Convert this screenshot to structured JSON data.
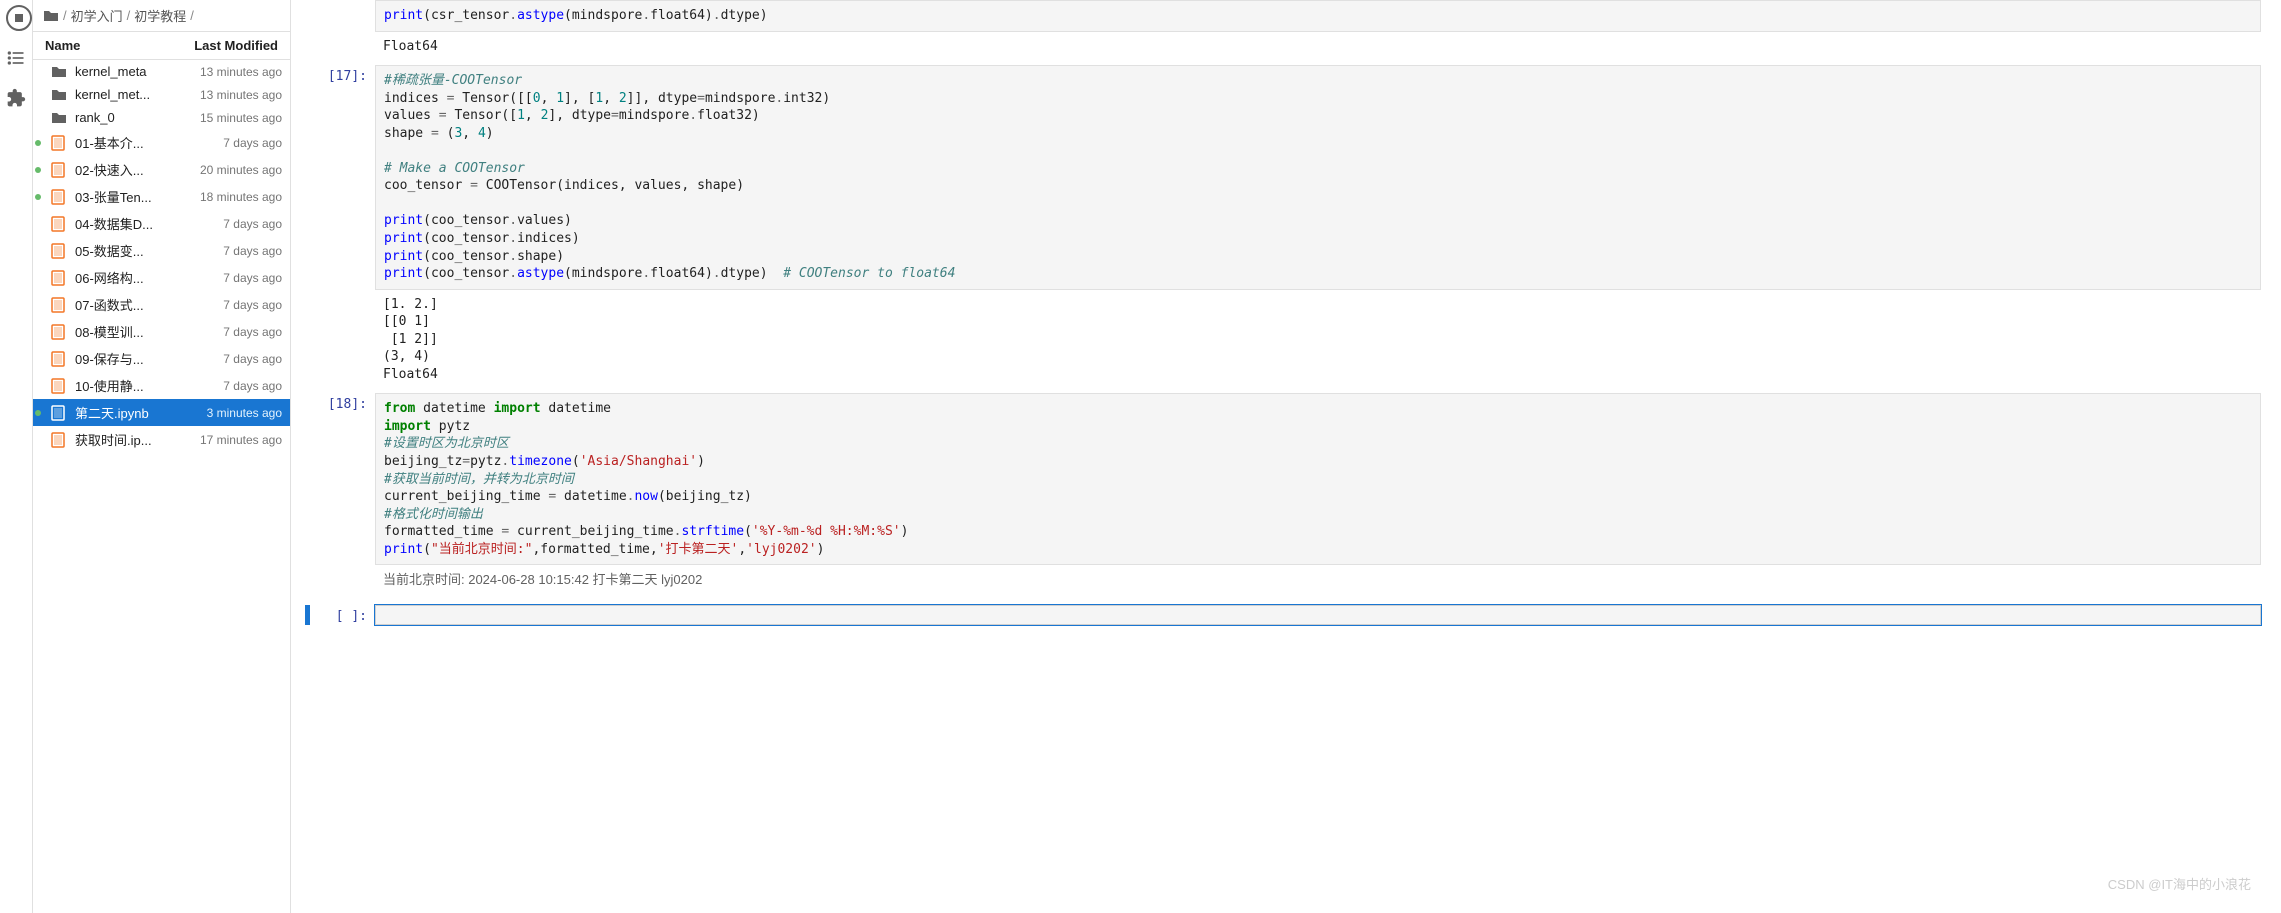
{
  "breadcrumb": {
    "parts": [
      "初学入门",
      "初学教程"
    ]
  },
  "file_header": {
    "name": "Name",
    "modified": "Last Modified"
  },
  "files": [
    {
      "name": "kernel_meta",
      "time": "13 minutes ago",
      "type": "folder",
      "running": false
    },
    {
      "name": "kernel_met...",
      "time": "13 minutes ago",
      "type": "folder",
      "running": false
    },
    {
      "name": "rank_0",
      "time": "15 minutes ago",
      "type": "folder",
      "running": false
    },
    {
      "name": "01-基本介...",
      "time": "7 days ago",
      "type": "notebook",
      "running": true
    },
    {
      "name": "02-快速入...",
      "time": "20 minutes ago",
      "type": "notebook",
      "running": true
    },
    {
      "name": "03-张量Ten...",
      "time": "18 minutes ago",
      "type": "notebook",
      "running": true
    },
    {
      "name": "04-数据集D...",
      "time": "7 days ago",
      "type": "notebook",
      "running": false
    },
    {
      "name": "05-数据变...",
      "time": "7 days ago",
      "type": "notebook",
      "running": false
    },
    {
      "name": "06-网络构...",
      "time": "7 days ago",
      "type": "notebook",
      "running": false
    },
    {
      "name": "07-函数式...",
      "time": "7 days ago",
      "type": "notebook",
      "running": false
    },
    {
      "name": "08-模型训...",
      "time": "7 days ago",
      "type": "notebook",
      "running": false
    },
    {
      "name": "09-保存与...",
      "time": "7 days ago",
      "type": "notebook",
      "running": false
    },
    {
      "name": "10-使用静...",
      "time": "7 days ago",
      "type": "notebook",
      "running": false
    },
    {
      "name": "第二天.ipynb",
      "time": "3 minutes ago",
      "type": "notebook",
      "running": true,
      "selected": true
    },
    {
      "name": "获取时间.ip...",
      "time": "17 minutes ago",
      "type": "notebook",
      "running": false
    }
  ],
  "cells": {
    "top_code_frag": "print(csr_tensor.astype(mindspore.float64).dtype)",
    "top_output": "Float64",
    "c17_prompt": "[17]:",
    "c17_output": "[1. 2.]\n[[0 1]\n [1 2]]\n(3, 4)\nFloat64",
    "c18_prompt": "[18]:",
    "c18_output": "当前北京时间: 2024-06-28 10:15:42 打卡第二天 lyj0202",
    "empty_prompt": "[ ]:"
  },
  "code17": {
    "cmt1": "#稀疏张量-COOTensor",
    "l2a": "indices ",
    "l2b": "=",
    "l2c": " Tensor([[",
    "l2d": "0",
    "l2e": ", ",
    "l2f": "1",
    "l2g": "], [",
    "l2h": "1",
    "l2i": ", ",
    "l2j": "2",
    "l2k": "]], dtype",
    "l2l": "=",
    "l2m": "mindspore",
    "l2n": ".",
    "l2o": "int32",
    "l2p": ")",
    "l3a": "values ",
    "l3b": "=",
    "l3c": " Tensor([",
    "l3d": "1",
    "l3e": ", ",
    "l3f": "2",
    "l3g": "], dtype",
    "l3h": "=",
    "l3i": "mindspore",
    "l3j": ".",
    "l3k": "float32",
    "l3l": ")",
    "l4a": "shape ",
    "l4b": "=",
    "l4c": " (",
    "l4d": "3",
    "l4e": ", ",
    "l4f": "4",
    "l4g": ")",
    "cmt2": "# Make a COOTensor",
    "l6a": "coo_tensor ",
    "l6b": "=",
    "l6c": " COOTensor(indices, values, shape)",
    "l8a": "print",
    "l8b": "(coo_tensor",
    "l8c": ".",
    "l8d": "values",
    "l8e": ")",
    "l9a": "print",
    "l9b": "(coo_tensor",
    "l9c": ".",
    "l9d": "indices",
    "l9e": ")",
    "l10a": "print",
    "l10b": "(coo_tensor",
    "l10c": ".",
    "l10d": "shape",
    "l10e": ")",
    "l11a": "print",
    "l11b": "(coo_tensor",
    "l11c": ".",
    "l11d": "astype",
    "l11e": "(mindspore",
    "l11f": ".",
    "l11g": "float64",
    "l11h": ")",
    "l11i": ".",
    "l11j": "dtype",
    "l11k": ")  ",
    "l11cmt": "# COOTensor to float64"
  },
  "code18": {
    "l1a": "from",
    "l1b": " datetime ",
    "l1c": "import",
    "l1d": " datetime",
    "l2a": "import",
    "l2b": " pytz",
    "cmt1": "#设置时区为北京时区",
    "l4a": "beijing_tz",
    "l4b": "=",
    "l4c": "pytz",
    "l4d": ".",
    "l4e": "timezone",
    "l4f": "(",
    "l4g": "'Asia/Shanghai'",
    "l4h": ")",
    "cmt2": "#获取当前时间，并转为北京时间",
    "l6a": "current_beijing_time ",
    "l6b": "=",
    "l6c": " datetime",
    "l6d": ".",
    "l6e": "now",
    "l6f": "(beijing_tz)",
    "cmt3": "#格式化时间输出",
    "l8a": "formatted_time ",
    "l8b": "=",
    "l8c": " current_beijing_time",
    "l8d": ".",
    "l8e": "strftime",
    "l8f": "(",
    "l8g": "'%Y-%m-%d %H:%M:%S'",
    "l8h": ")",
    "l9a": "print",
    "l9b": "(",
    "l9c": "\"当前北京时间:\"",
    "l9d": ",formatted_time,",
    "l9e": "'打卡第二天'",
    "l9f": ",",
    "l9g": "'lyj0202'",
    "l9h": ")"
  },
  "watermark": "CSDN @IT海中的小浪花"
}
